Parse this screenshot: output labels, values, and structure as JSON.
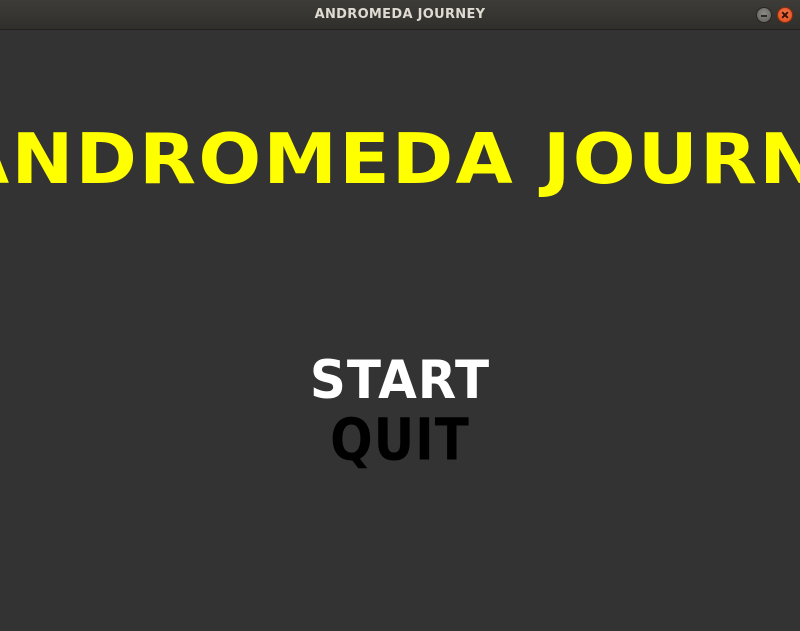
{
  "window": {
    "title": "ANDROMEDA JOURNEY"
  },
  "game": {
    "title": "ANDROMEDA JOURNEY",
    "title_color": "#ffff00",
    "background_color": "#333333",
    "menu": [
      {
        "label": "START",
        "color": "#ffffff",
        "selected": true
      },
      {
        "label": "QUIT",
        "color": "#000000",
        "selected": false
      }
    ]
  }
}
